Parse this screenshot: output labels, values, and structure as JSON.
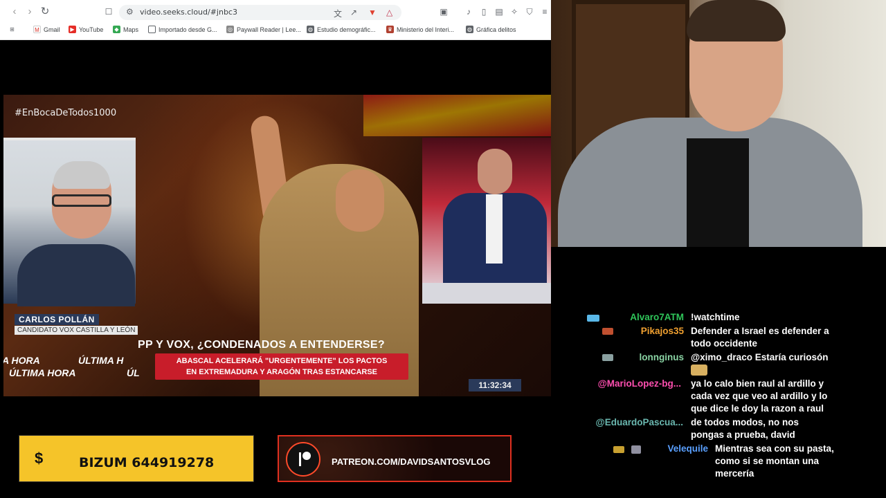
{
  "browser": {
    "url": "video.seeks.cloud/#jnbc3",
    "bookmarks": [
      {
        "label": "Gmail"
      },
      {
        "label": "YouTube"
      },
      {
        "label": "Maps"
      },
      {
        "label": "Importado desde G..."
      },
      {
        "label": "Paywall Reader | Lee..."
      },
      {
        "label": "Estudio demográfic..."
      },
      {
        "label": "Ministerio del Interi..."
      },
      {
        "label": "Gráfica delitos"
      }
    ]
  },
  "video": {
    "hashtag": "#EnBocaDeTodos1000",
    "guest_name": "CARLOS POLLÁN",
    "guest_title": "CANDIDATO VOX CASTILLA Y LEÓN",
    "headline": "PP Y VOX, ¿CONDENADOS A ENTENDERSE?",
    "subheadline_1": "ABASCAL ACELERARÁ \"URGENTEMENTE\" LOS PACTOS",
    "subheadline_2": "EN EXTREMADURA Y ARAGÓN TRAS ESTANCARSE",
    "ticker_1": "A HORA",
    "ticker_2": "ÚLTIMA H",
    "ticker_3": "ÚLTIMA HORA",
    "ticker_4": "ÚL",
    "clock": "11:32:34"
  },
  "banners": {
    "bizum_symbol": "$",
    "bizum_text": "BIZUM 644919278",
    "patreon_text": "PATREON.COM/DAVIDSANTOSVLOG"
  },
  "chat": {
    "messages": [
      {
        "user": "Alvaro7ATM",
        "text": "!watchtime"
      },
      {
        "user": "Pikajos35",
        "text_1": "Defender a Israel es defender a",
        "text_2": "todo occidente"
      },
      {
        "user": "lonnginus",
        "text": "@ximo_draco Estaría curiosón"
      },
      {
        "user": "@MarioLopez-bg...",
        "text_1": "ya lo calo bien raul al ardillo y",
        "text_2": "cada vez que veo al ardillo y lo",
        "text_3": "que dice le doy la razon a raul"
      },
      {
        "user": "@EduardoPascua...",
        "text_1": "de todos modos, no nos",
        "text_2": "pongas a prueba, david"
      },
      {
        "user": "Velequile",
        "text_1": "Mientras sea con su pasta,",
        "text_2": "como si se montan una",
        "text_3": "mercería"
      }
    ]
  },
  "colors": {
    "chat_green": "#2fc65a",
    "chat_orange": "#f0a030",
    "chat_mint": "#8ad4a4",
    "chat_pink": "#ff4fb0",
    "chat_teal": "#6ab8b0",
    "chat_blue": "#5aa0ff"
  }
}
